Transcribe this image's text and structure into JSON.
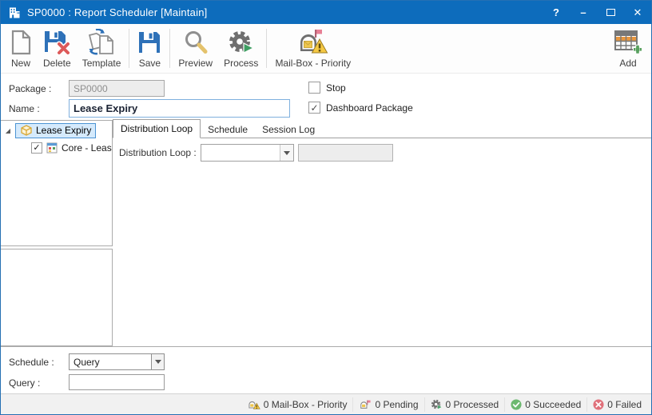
{
  "window": {
    "title": "SP0000 : Report Scheduler [Maintain]",
    "controls": {
      "help": "?",
      "minimize": "–",
      "close": "✕"
    }
  },
  "toolbar": {
    "items": [
      {
        "label": "New"
      },
      {
        "label": "Delete"
      },
      {
        "label": "Template"
      },
      {
        "label": "Save"
      },
      {
        "label": "Preview"
      },
      {
        "label": "Process"
      },
      {
        "label": "Mail-Box - Priority"
      },
      {
        "label": "Add"
      }
    ]
  },
  "form": {
    "package_label": "Package :",
    "package_value": "SP0000",
    "name_label": "Name :",
    "name_value": "Lease Expiry",
    "stop_label": "Stop",
    "stop_checked": false,
    "dashboard_label": "Dashboard Package",
    "dashboard_checked": true
  },
  "tree": {
    "root_label": "Lease Expiry",
    "child_label": "Core - Leas",
    "child_checked": true
  },
  "tabs": [
    {
      "label": "Distribution Loop",
      "active": true
    },
    {
      "label": "Schedule",
      "active": false
    },
    {
      "label": "Session Log",
      "active": false
    }
  ],
  "content": {
    "distribution_loop_label": "Distribution Loop :",
    "distribution_loop_value": ""
  },
  "bottom": {
    "schedule_label": "Schedule :",
    "schedule_value": "Query",
    "query_label": "Query :",
    "query_value": ""
  },
  "statusbar": {
    "items": [
      {
        "icon": "mailbox-warning-icon",
        "label": "0 Mail-Box - Priority"
      },
      {
        "icon": "mailbox-pending-icon",
        "label": "0 Pending"
      },
      {
        "icon": "gear-icon",
        "label": "0 Processed"
      },
      {
        "icon": "check-circle-icon",
        "label": "0 Succeeded"
      },
      {
        "icon": "fail-circle-icon",
        "label": "0 Failed"
      }
    ]
  },
  "colors": {
    "titlebar": "#0d6cbc",
    "accent_blue": "#2e71b8",
    "selection_bg": "#d5eafc",
    "selection_border": "#4b94d4",
    "warning_yellow": "#f5c843",
    "success_green": "#6cb86f",
    "fail_red": "#e0707a",
    "orange_row": "#e8973f"
  }
}
